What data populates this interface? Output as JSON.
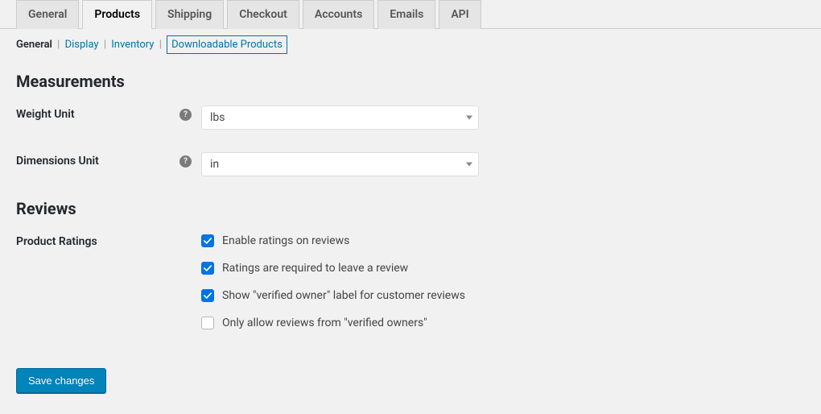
{
  "tabs": {
    "items": [
      {
        "label": "General"
      },
      {
        "label": "Products"
      },
      {
        "label": "Shipping"
      },
      {
        "label": "Checkout"
      },
      {
        "label": "Accounts"
      },
      {
        "label": "Emails"
      },
      {
        "label": "API"
      }
    ],
    "active_index": 1
  },
  "subnav": {
    "items": [
      {
        "label": "General",
        "current": true
      },
      {
        "label": "Display"
      },
      {
        "label": "Inventory"
      },
      {
        "label": "Downloadable Products",
        "boxed": true
      }
    ]
  },
  "sections": {
    "measurements": {
      "heading": "Measurements"
    },
    "reviews": {
      "heading": "Reviews"
    }
  },
  "fields": {
    "weight_unit": {
      "label": "Weight Unit",
      "value": "lbs",
      "help": "?"
    },
    "dimensions_unit": {
      "label": "Dimensions Unit",
      "value": "in",
      "help": "?"
    },
    "product_ratings": {
      "label": "Product Ratings",
      "options": [
        {
          "label": "Enable ratings on reviews",
          "checked": true
        },
        {
          "label": "Ratings are required to leave a review",
          "checked": true
        },
        {
          "label": "Show \"verified owner\" label for customer reviews",
          "checked": true
        },
        {
          "label": "Only allow reviews from \"verified owners\"",
          "checked": false
        }
      ]
    }
  },
  "actions": {
    "save": "Save changes"
  }
}
